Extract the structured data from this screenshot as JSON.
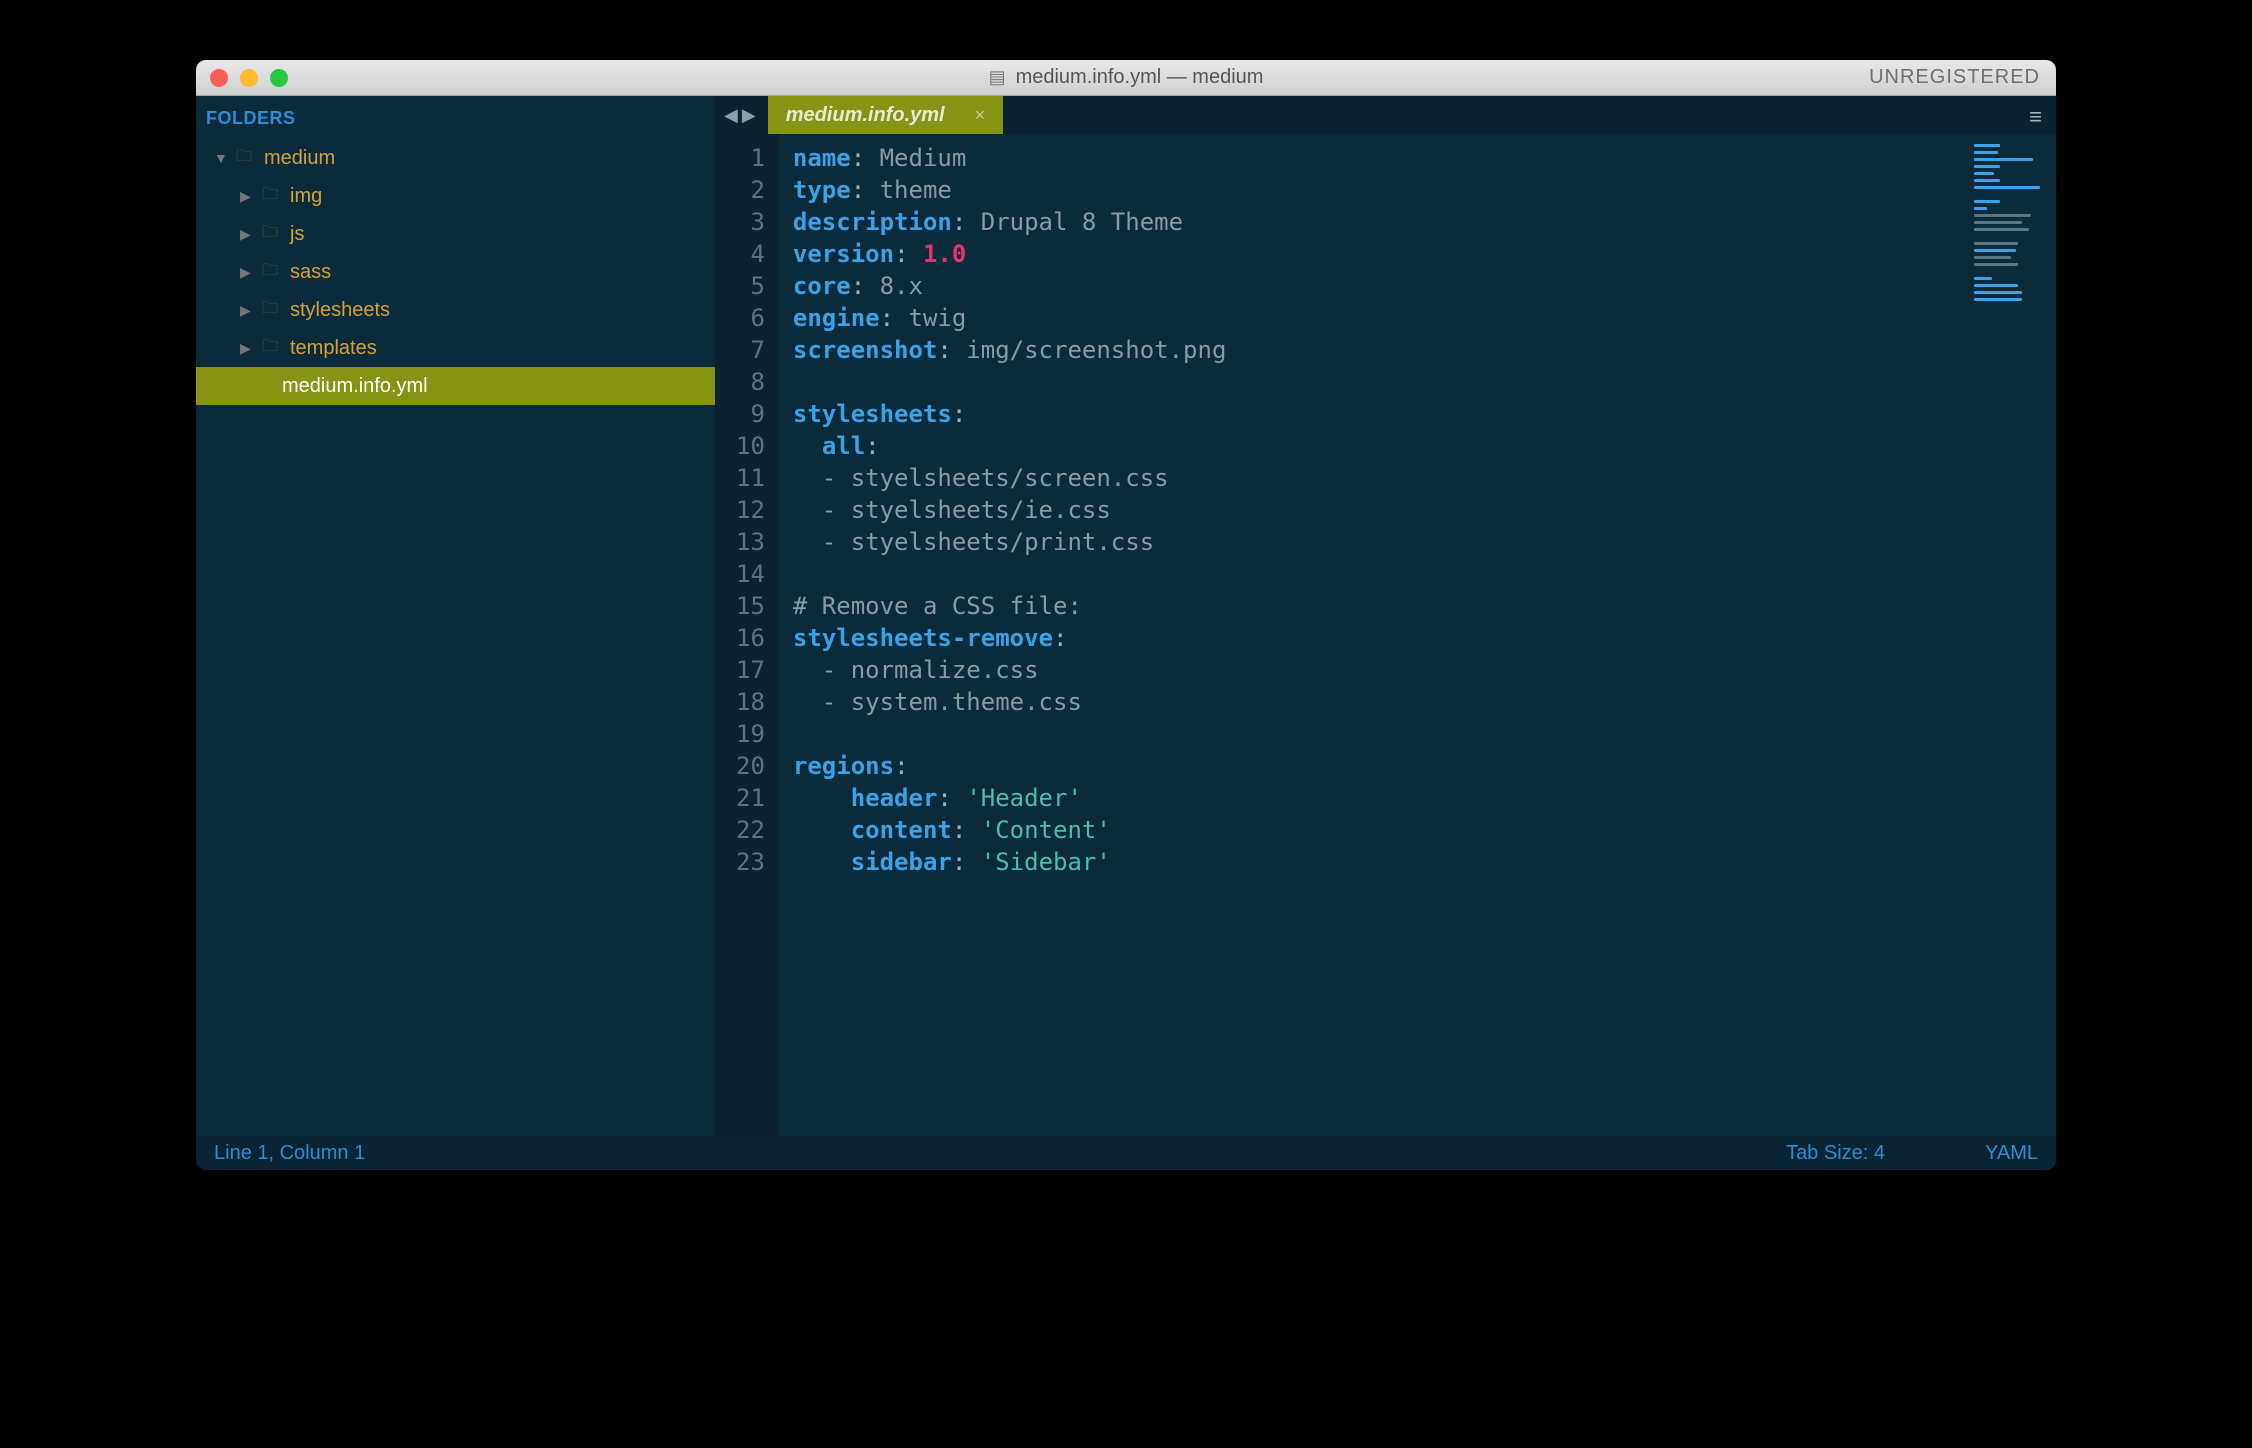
{
  "titlebar": {
    "title": "medium.info.yml — medium",
    "unregistered": "UNREGISTERED"
  },
  "sidebar": {
    "header": "FOLDERS",
    "root": "medium",
    "folders": [
      "img",
      "js",
      "sass",
      "stylesheets",
      "templates"
    ],
    "file": "medium.info.yml"
  },
  "tab": {
    "label": "medium.info.yml"
  },
  "code": {
    "lines": [
      {
        "n": "1",
        "seg": [
          {
            "c": "k",
            "t": "name"
          },
          {
            "c": "p",
            "t": ":"
          },
          {
            "c": "v",
            "t": " Medium"
          }
        ]
      },
      {
        "n": "2",
        "seg": [
          {
            "c": "k",
            "t": "type"
          },
          {
            "c": "p",
            "t": ":"
          },
          {
            "c": "v",
            "t": " theme"
          }
        ]
      },
      {
        "n": "3",
        "seg": [
          {
            "c": "k",
            "t": "description"
          },
          {
            "c": "p",
            "t": ":"
          },
          {
            "c": "v",
            "t": " Drupal 8 Theme"
          }
        ]
      },
      {
        "n": "4",
        "seg": [
          {
            "c": "k",
            "t": "version"
          },
          {
            "c": "p",
            "t": ":"
          },
          {
            "c": "num",
            "t": " 1.0"
          }
        ]
      },
      {
        "n": "5",
        "seg": [
          {
            "c": "k",
            "t": "core"
          },
          {
            "c": "p",
            "t": ":"
          },
          {
            "c": "v",
            "t": " 8.x"
          }
        ]
      },
      {
        "n": "6",
        "seg": [
          {
            "c": "k",
            "t": "engine"
          },
          {
            "c": "p",
            "t": ":"
          },
          {
            "c": "v",
            "t": " twig"
          }
        ]
      },
      {
        "n": "7",
        "seg": [
          {
            "c": "k",
            "t": "screenshot"
          },
          {
            "c": "p",
            "t": ":"
          },
          {
            "c": "v",
            "t": " img/screenshot.png"
          }
        ]
      },
      {
        "n": "8",
        "seg": []
      },
      {
        "n": "9",
        "seg": [
          {
            "c": "k",
            "t": "stylesheets"
          },
          {
            "c": "p",
            "t": ":"
          }
        ]
      },
      {
        "n": "10",
        "seg": [
          {
            "c": "p",
            "t": "  "
          },
          {
            "c": "k",
            "t": "all"
          },
          {
            "c": "p",
            "t": ":"
          }
        ]
      },
      {
        "n": "11",
        "seg": [
          {
            "c": "v",
            "t": "  - styelsheets/screen.css"
          }
        ]
      },
      {
        "n": "12",
        "seg": [
          {
            "c": "v",
            "t": "  - styelsheets/ie.css"
          }
        ]
      },
      {
        "n": "13",
        "seg": [
          {
            "c": "v",
            "t": "  - styelsheets/print.css"
          }
        ]
      },
      {
        "n": "14",
        "seg": []
      },
      {
        "n": "15",
        "seg": [
          {
            "c": "cm",
            "t": "# Remove a CSS file:"
          }
        ]
      },
      {
        "n": "16",
        "seg": [
          {
            "c": "k",
            "t": "stylesheets-remove"
          },
          {
            "c": "p",
            "t": ":"
          }
        ]
      },
      {
        "n": "17",
        "seg": [
          {
            "c": "v",
            "t": "  - normalize.css"
          }
        ]
      },
      {
        "n": "18",
        "seg": [
          {
            "c": "v",
            "t": "  - system.theme.css"
          }
        ]
      },
      {
        "n": "19",
        "seg": []
      },
      {
        "n": "20",
        "seg": [
          {
            "c": "k",
            "t": "regions"
          },
          {
            "c": "p",
            "t": ":"
          }
        ]
      },
      {
        "n": "21",
        "seg": [
          {
            "c": "p",
            "t": "    "
          },
          {
            "c": "k",
            "t": "header"
          },
          {
            "c": "p",
            "t": ": "
          },
          {
            "c": "str",
            "t": "'Header'"
          }
        ]
      },
      {
        "n": "22",
        "seg": [
          {
            "c": "p",
            "t": "    "
          },
          {
            "c": "k",
            "t": "content"
          },
          {
            "c": "p",
            "t": ": "
          },
          {
            "c": "str",
            "t": "'Content'"
          }
        ]
      },
      {
        "n": "23",
        "seg": [
          {
            "c": "p",
            "t": "    "
          },
          {
            "c": "k",
            "t": "sidebar"
          },
          {
            "c": "p",
            "t": ": "
          },
          {
            "c": "str",
            "t": "'Sidebar'"
          }
        ]
      }
    ]
  },
  "status": {
    "pos": "Line 1, Column 1",
    "tabsize": "Tab Size: 4",
    "syntax": "YAML"
  }
}
